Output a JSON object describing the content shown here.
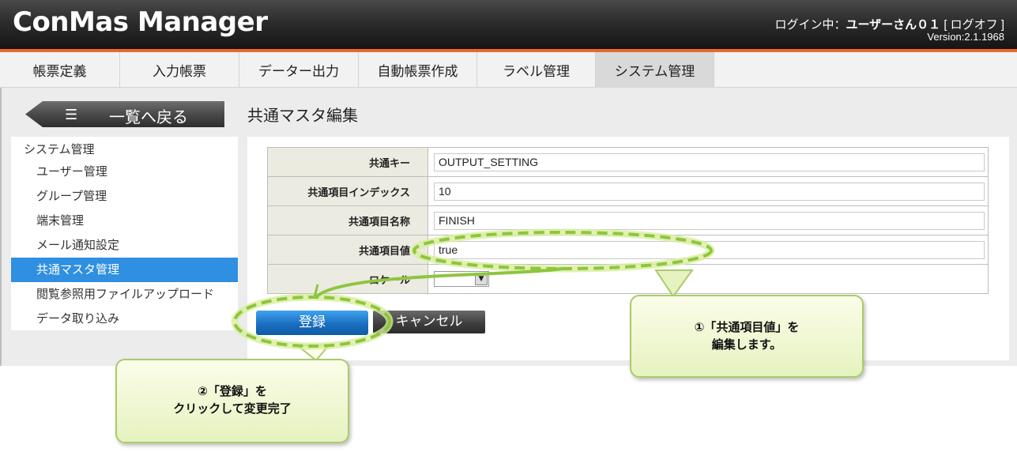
{
  "header": {
    "app_title": "ConMas Manager",
    "login_prefix": "ログイン中：",
    "user_name": "ユーザーさん０１",
    "logoff_label": "[ ログオフ ]",
    "version": "Version:2.1.1968"
  },
  "nav": {
    "tabs": [
      {
        "label": "帳票定義"
      },
      {
        "label": "入力帳票"
      },
      {
        "label": "データー出力"
      },
      {
        "label": "自動帳票作成"
      },
      {
        "label": "ラベル管理"
      },
      {
        "label": "システム管理",
        "active": true
      }
    ]
  },
  "back_button": {
    "label": "一覧へ戻る",
    "icon": "list-icon"
  },
  "page_title": "共通マスタ編集",
  "sidebar": {
    "root_label": "システム管理",
    "items": [
      {
        "label": "ユーザー管理"
      },
      {
        "label": "グループ管理"
      },
      {
        "label": "端末管理"
      },
      {
        "label": "メール通知設定"
      },
      {
        "label": "共通マスタ管理",
        "active": true
      },
      {
        "label": "閲覧参照用ファイルアップロード"
      },
      {
        "label": "データ取り込み"
      }
    ]
  },
  "form": {
    "fields": [
      {
        "label": "共通キー",
        "value": "OUTPUT_SETTING"
      },
      {
        "label": "共通項目インデックス",
        "value": "10"
      },
      {
        "label": "共通項目名称",
        "value": "FINISH"
      },
      {
        "label": "共通項目値",
        "value": "true"
      },
      {
        "label": "ロケール",
        "value": ""
      }
    ]
  },
  "buttons": {
    "register": "登録",
    "cancel": "キャンセル"
  },
  "annotations": {
    "callout1": {
      "line1": "①「共通項目値」を",
      "line2": "編集します。"
    },
    "callout2": {
      "line1": "②「登録」を",
      "line2": "クリックして変更完了"
    }
  },
  "colors": {
    "header_bg": "#1e1e1e",
    "accent_orange": "#e8692a",
    "selected_blue": "#2f8fe0",
    "register_blue": "#1b6fc0",
    "highlight_green": "#8dc63f",
    "callout_bg": "#e6f2c0"
  }
}
